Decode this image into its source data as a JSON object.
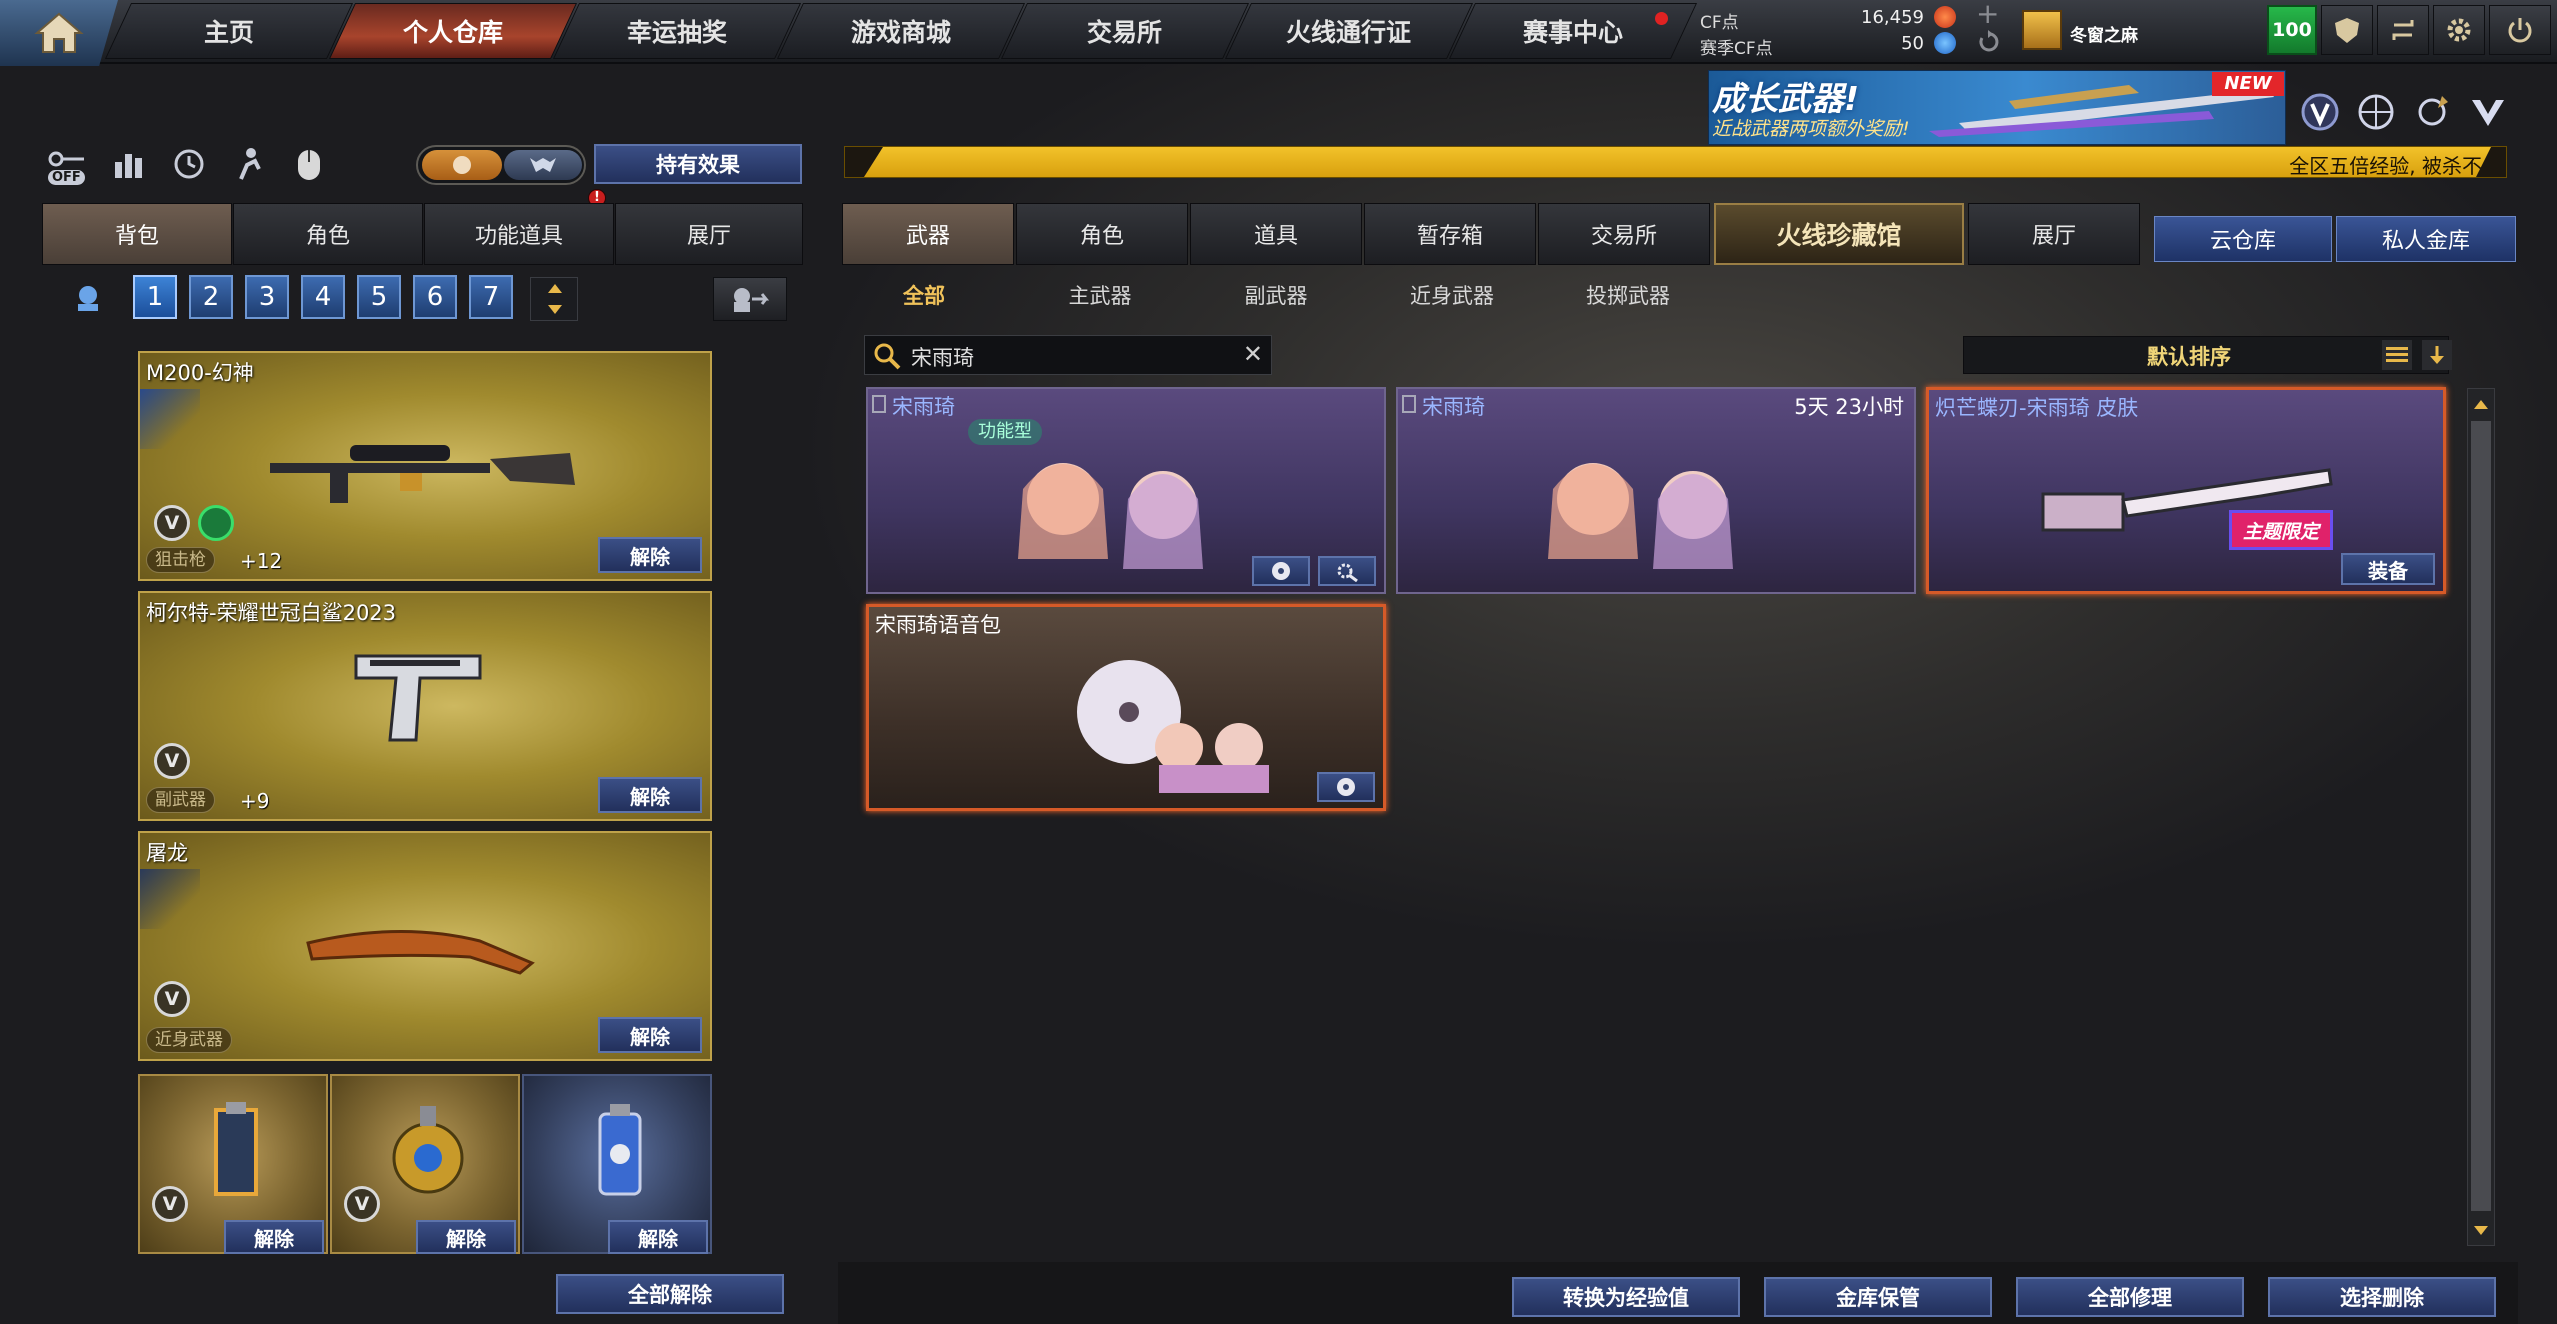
{
  "nav": {
    "tabs": [
      "主页",
      "个人仓库",
      "幸运抽奖",
      "游戏商城",
      "交易所",
      "火线通行证",
      "赛事中心"
    ],
    "active_tab": "个人仓库"
  },
  "currency": {
    "cf_label": "CF点",
    "cf_value": "16,459",
    "season_label": "赛季CF点",
    "season_value": "50"
  },
  "player": {
    "name": "冬窗之麻",
    "level": "100"
  },
  "promo": {
    "title": "成长武器!",
    "subtitle": "近战武器两项额外奖励!",
    "new_badge": "NEW"
  },
  "ticker": "全区五倍经验, 被杀不",
  "left": {
    "toggle_off": "OFF",
    "effect_button": "持有效果",
    "alert": "!",
    "tabs": [
      "背包",
      "角色",
      "功能道具",
      "展厅"
    ],
    "active_tab": "背包",
    "pages": [
      "1",
      "2",
      "3",
      "4",
      "5",
      "6",
      "7"
    ],
    "active_page": "1",
    "weapons": [
      {
        "name": "M200-幻神",
        "type": "狙击枪",
        "level": "+12",
        "button": "解除",
        "v": "V"
      },
      {
        "name": "柯尔特-荣耀世冠白鲨2023",
        "type": "副武器",
        "level": "+9",
        "button": "解除",
        "v": "V"
      },
      {
        "name": "屠龙",
        "type": "近身武器",
        "level": "",
        "button": "解除",
        "v": "V"
      }
    ],
    "grenades": [
      {
        "button": "解除",
        "v": "V"
      },
      {
        "button": "解除",
        "v": "V"
      },
      {
        "button": "解除",
        "v": ""
      }
    ],
    "unequip_all": "全部解除"
  },
  "right": {
    "tabs": [
      "武器",
      "角色",
      "道具",
      "暂存箱",
      "交易所",
      "火线珍藏馆",
      "展厅"
    ],
    "active_tab": "武器",
    "cloud_tabs": [
      "云仓库",
      "私人金库"
    ],
    "subtabs": [
      "全部",
      "主武器",
      "副武器",
      "近身武器",
      "投掷武器"
    ],
    "active_subtab": "全部",
    "search_value": "宋雨琦",
    "sort_label": "默认排序",
    "items": [
      {
        "name": "宋雨琦",
        "badge": "功能型",
        "time": ""
      },
      {
        "name": "宋雨琦",
        "badge": "",
        "time": "5天 23小时"
      },
      {
        "name": "炽芒蝶刃-宋雨琦 皮肤",
        "badge": "",
        "time": "",
        "tag": "主题限定",
        "button": "装备"
      },
      {
        "name": "宋雨琦语音包",
        "badge": "",
        "time": ""
      }
    ],
    "bottom_buttons": [
      "转换为经验值",
      "金库保管",
      "全部修理",
      "选择删除"
    ]
  }
}
